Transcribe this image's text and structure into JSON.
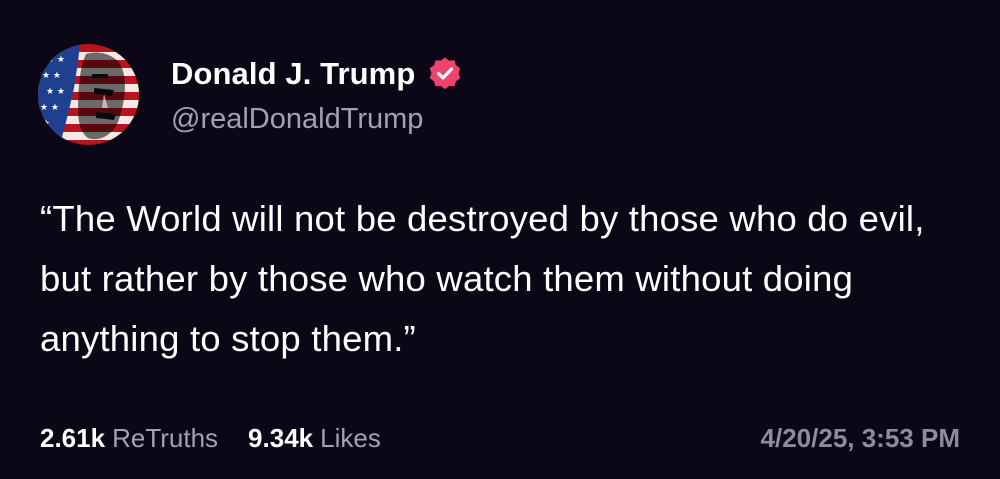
{
  "author": {
    "display_name": "Donald J. Trump",
    "handle": "@realDonaldTrump",
    "verified": true,
    "avatar_icon": "flag-portrait-avatar",
    "verified_icon": "verified-badge-icon"
  },
  "post": {
    "text": "“The World will not be destroyed by those who do evil, but rather by those who watch them without doing anything to stop them.”"
  },
  "stats": {
    "retruths_count": "2.61k",
    "retruths_label": "ReTruths",
    "likes_count": "9.34k",
    "likes_label": "Likes"
  },
  "timestamp": "4/20/25, 3:53 PM",
  "colors": {
    "background": "#0b0716",
    "text_primary": "#ffffff",
    "text_secondary": "#a3a1b0",
    "verified_badge": "#f0426b"
  }
}
